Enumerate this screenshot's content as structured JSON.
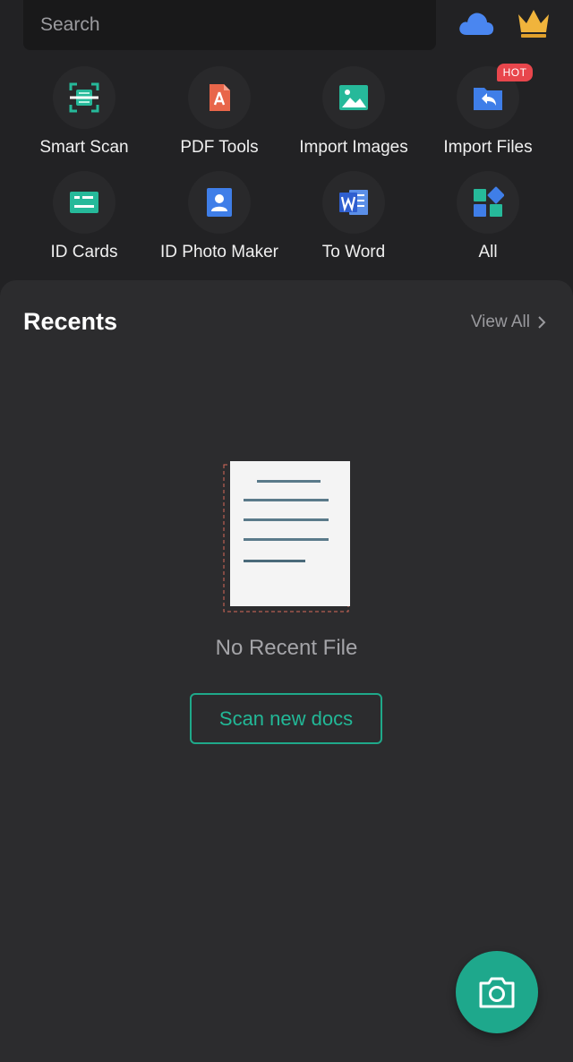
{
  "header": {
    "search_placeholder": "Search",
    "cloud_icon": "cloud-icon",
    "premium_icon": "crown-icon"
  },
  "tools": [
    {
      "label": "Smart Scan",
      "icon": "smart-scan-icon",
      "color": "#26b99a"
    },
    {
      "label": "PDF Tools",
      "icon": "pdf-tools-icon",
      "color": "#e8664a"
    },
    {
      "label": "Import Images",
      "icon": "image-icon",
      "color": "#26b99a"
    },
    {
      "label": "Import Files",
      "icon": "import-file-icon",
      "color": "#3f7ee8",
      "badge": "HOT"
    },
    {
      "label": "ID Cards",
      "icon": "id-card-icon",
      "color": "#26b99a"
    },
    {
      "label": "ID Photo Maker",
      "icon": "id-photo-icon",
      "color": "#3f7ee8"
    },
    {
      "label": "To Word",
      "icon": "word-icon",
      "color": "#2f5fd0"
    },
    {
      "label": "All",
      "icon": "all-apps-icon",
      "color": "#26b99a"
    }
  ],
  "recents": {
    "title": "Recents",
    "view_all": "View All",
    "empty_text": "No Recent File",
    "scan_button": "Scan new docs"
  },
  "fab": {
    "icon": "camera-icon",
    "color": "#1ea88c"
  },
  "colors": {
    "accent": "#1fa98a",
    "background": "#222224",
    "panel": "#2c2c2e",
    "hot_badge": "#e8464c"
  }
}
